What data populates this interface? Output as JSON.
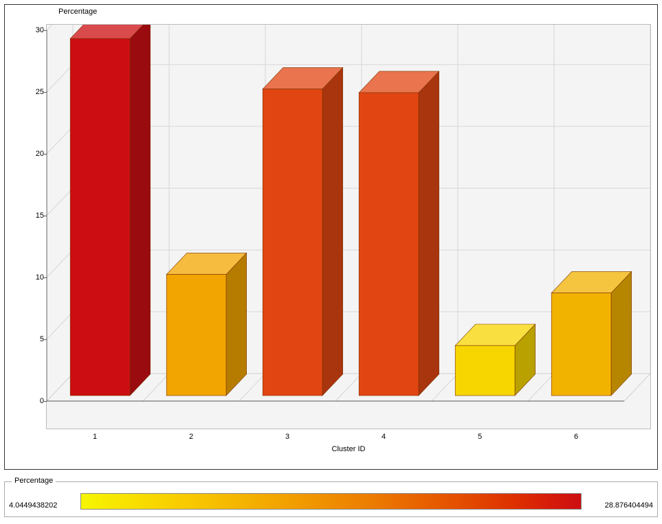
{
  "chart_data": {
    "type": "bar",
    "categories": [
      "1",
      "2",
      "3",
      "4",
      "5",
      "6"
    ],
    "values": [
      28.876404494,
      9.8,
      24.8,
      24.5,
      4.0449438202,
      8.3
    ],
    "colors": [
      "#cc0e12",
      "#f2a500",
      "#e14612",
      "#e14612",
      "#f7d600",
      "#f2b200"
    ],
    "title": "",
    "xlabel": "Cluster ID",
    "ylabel": "Percentage",
    "ylim": [
      0,
      30
    ],
    "yticks": [
      0,
      5,
      10,
      15,
      20,
      25,
      30
    ]
  },
  "legend": {
    "title": "Percentage",
    "min": "4.0449438202",
    "max": "28.876404494"
  }
}
